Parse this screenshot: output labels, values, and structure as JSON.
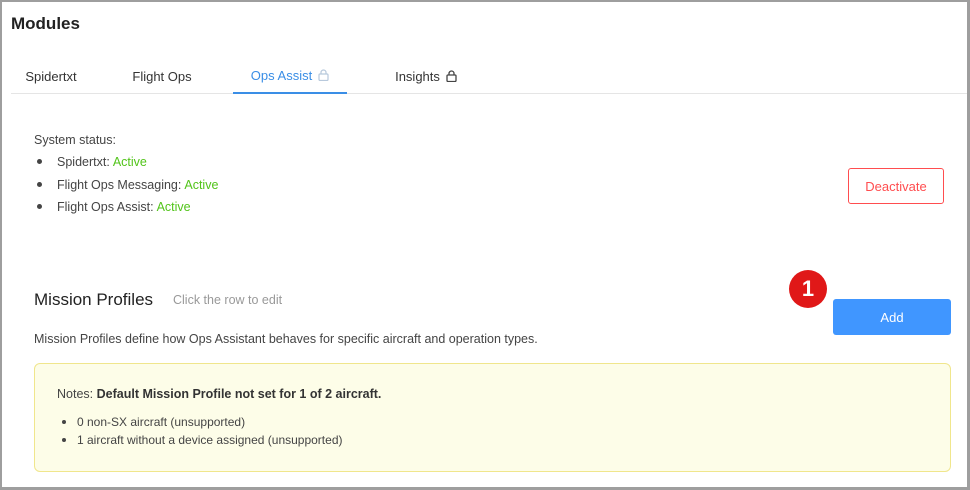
{
  "page": {
    "title": "Modules"
  },
  "tabs": [
    {
      "label": "Spidertxt",
      "locked": false,
      "active": false
    },
    {
      "label": "Flight Ops",
      "locked": false,
      "active": false
    },
    {
      "label": "Ops Assist",
      "locked": true,
      "active": true
    },
    {
      "label": "Insights",
      "locked": true,
      "active": false
    }
  ],
  "status": {
    "label": "System status:",
    "items": [
      {
        "name": "Spidertxt:",
        "value": "Active"
      },
      {
        "name": "Flight Ops Messaging:",
        "value": "Active"
      },
      {
        "name": "Flight Ops Assist:",
        "value": "Active"
      }
    ],
    "deactivate_label": "Deactivate"
  },
  "mission_profiles": {
    "title": "Mission Profiles",
    "hint": "Click the row to edit",
    "description": "Mission Profiles define how Ops Assistant behaves for specific aircraft and operation types.",
    "add_label": "Add",
    "callout_number": "1"
  },
  "notes": {
    "prefix": "Notes:",
    "headline": "Default Mission Profile not set for 1 of 2 aircraft.",
    "items": [
      "0 non-SX aircraft (unsupported)",
      "1 aircraft without a device assigned (unsupported)"
    ]
  },
  "colors": {
    "accent": "#3a8ee6",
    "primary_button": "#4096ff",
    "danger": "#ff4d4f",
    "success": "#52c41a",
    "callout": "#e01818",
    "notes_bg": "#fdfde8"
  }
}
